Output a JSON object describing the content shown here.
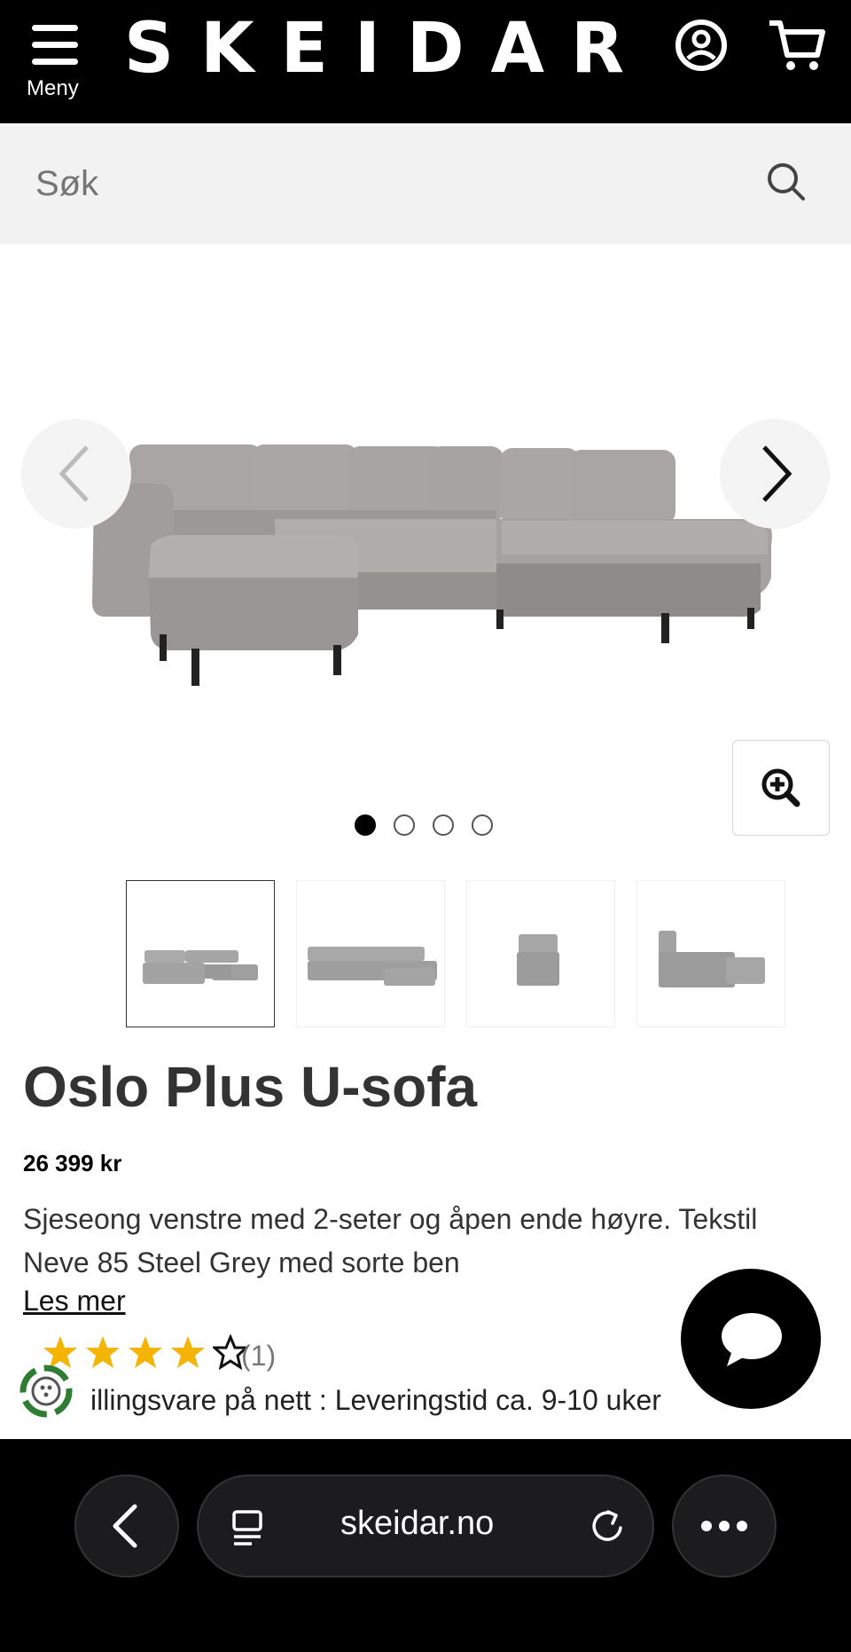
{
  "header": {
    "menu_label": "Meny",
    "logo": "SKEIDAR",
    "icons": [
      "user-icon",
      "cart-icon"
    ]
  },
  "search": {
    "placeholder": "Søk",
    "icon": "search-icon"
  },
  "gallery": {
    "active_index": 0,
    "image_count": 4,
    "icons": [
      "chevron-left-icon",
      "chevron-right-icon",
      "zoom-in-icon"
    ]
  },
  "product": {
    "title": "Oslo Plus U-sofa",
    "price": "26 399 kr",
    "description": "Sjeseong venstre med 2-seter og åpen ende høyre. Tekstil Neve 85 Steel Grey med sorte ben",
    "read_more": "Les mer",
    "rating": 4,
    "rating_max": 5,
    "review_count": "(1)",
    "delivery": "illingsvare på nett : Leveringstid ca. 9-10 uker"
  },
  "colors": {
    "header_bg": "#000000",
    "star": "#f5b400",
    "search_bg": "#f2f2f2"
  },
  "browser": {
    "url": "skeidar.no",
    "icons": [
      "back-icon",
      "tabs-icon",
      "reload-icon",
      "more-icon"
    ]
  }
}
